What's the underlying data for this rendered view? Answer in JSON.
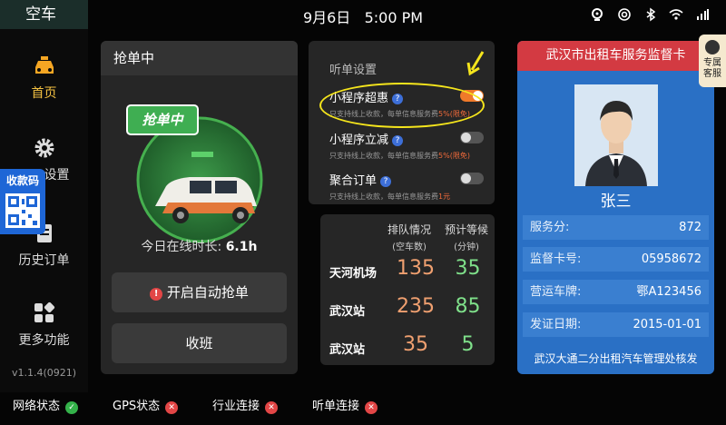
{
  "app_title": "空车",
  "status_bar": {
    "date": "9月6日",
    "time": "5:00 PM",
    "icons": [
      "camera-icon",
      "hotspot-icon",
      "bluetooth-icon",
      "wifi-icon",
      "signal-icon"
    ]
  },
  "sidebar": {
    "items": [
      {
        "label": "首页",
        "icon": "taxi-icon",
        "active": true
      },
      {
        "label": "设置",
        "icon": "gear-icon"
      },
      {
        "label": "历史订单",
        "icon": "document-icon"
      },
      {
        "label": "更多功能",
        "icon": "grid-icon"
      }
    ],
    "version": "v1.1.4(0921)"
  },
  "qr_pay": {
    "label": "收款码"
  },
  "grab_panel": {
    "title": "抢单中",
    "bubble": "抢单中",
    "online_label": "今日在线时长:",
    "online_value": "6.1h",
    "auto_grab_button": "开启自动抢单",
    "end_shift_button": "收班"
  },
  "settings": {
    "title": "听单设置",
    "rows": [
      {
        "name": "小程序超惠",
        "desc": "只支持线上收款，每单信息服务费",
        "rate": "5%",
        "note": "(限免)",
        "on": true
      },
      {
        "name": "小程序立减",
        "desc": "只支持线上收款，每单信息服务费",
        "rate": "5%",
        "note": "(限免)",
        "on": false
      },
      {
        "name": "聚合订单",
        "desc": "只支持线上收款，每单信息服务费",
        "rate": "1元",
        "note": "",
        "on": false
      }
    ],
    "accent": "#f07a2a"
  },
  "queue": {
    "header_cars": "排队情况",
    "sub_cars": "(空车数)",
    "header_wait": "预计等候",
    "sub_wait": "(分钟)",
    "rows": [
      {
        "place": "天河机场",
        "cars": "135",
        "wait": "35"
      },
      {
        "place": "武汉站",
        "cars": "235",
        "wait": "85"
      },
      {
        "place": "武汉站",
        "cars": "35",
        "wait": "5"
      }
    ]
  },
  "card": {
    "title": "武汉市出租车服务监督卡",
    "name": "张三",
    "fields": [
      {
        "key": "服务分:",
        "value": "872"
      },
      {
        "key": "监督卡号:",
        "value": "05958672"
      },
      {
        "key": "营运车牌:",
        "value": "鄂A123456"
      },
      {
        "key": "发证日期:",
        "value": "2015-01-01"
      }
    ],
    "org": "武汉大通二分出租汽车管理处核发"
  },
  "customer_service": {
    "label_1": "专属",
    "label_2": "客服"
  },
  "bottom_status": [
    {
      "label": "网络状态",
      "ok": true
    },
    {
      "label": "GPS状态",
      "ok": false
    },
    {
      "label": "行业连接",
      "ok": false
    },
    {
      "label": "听单连接",
      "ok": false
    }
  ]
}
